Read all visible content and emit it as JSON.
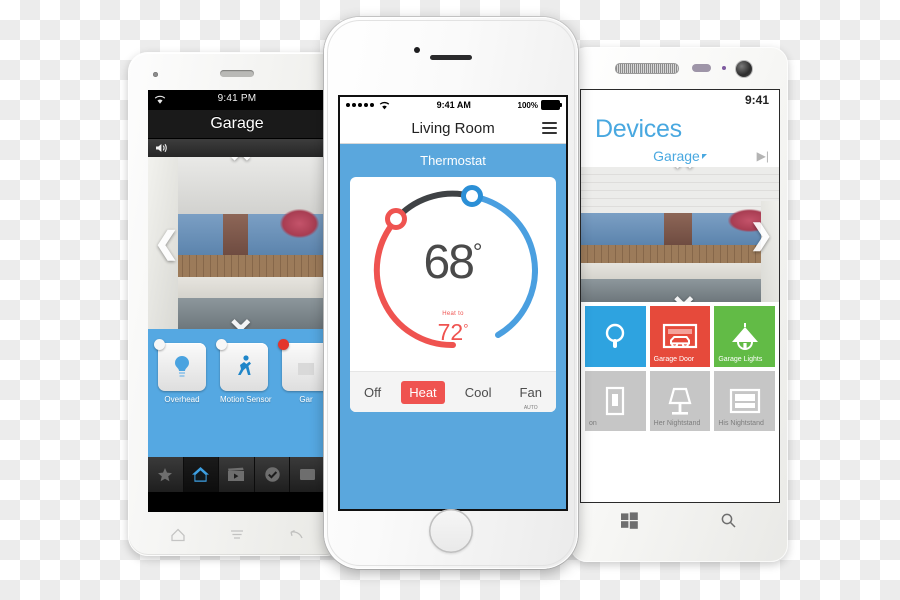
{
  "android_phone": {
    "status": {
      "time": "9:41 PM",
      "wifi_icon": "wifi-icon"
    },
    "title": "Garage",
    "camera_bar": {
      "speaker_icon": "speaker-icon"
    },
    "nav_arrows": {
      "left": "❮",
      "up": "⌃",
      "down": "⌄"
    },
    "tiles": [
      {
        "label": "Overhead",
        "icon": "lightbulb-icon",
        "status_dot": "white"
      },
      {
        "label": "Motion Sensor",
        "icon": "running-person-icon",
        "status_dot": "white"
      },
      {
        "label": "Gar",
        "icon": "garage-icon",
        "status_dot": "red"
      }
    ],
    "tabbar": [
      {
        "icon": "star-icon",
        "active": false
      },
      {
        "icon": "home-icon",
        "active": true
      },
      {
        "icon": "video-clapper-icon",
        "active": false
      },
      {
        "icon": "check-circle-icon",
        "active": false
      },
      {
        "icon": "message-icon",
        "active": false
      }
    ],
    "softkeys": [
      {
        "icon": "home-outline-icon"
      },
      {
        "icon": "menu-lines-icon"
      },
      {
        "icon": "back-arrow-icon"
      }
    ]
  },
  "iphone": {
    "status": {
      "signal_dots": 5,
      "wifi_icon": "wifi-icon",
      "time": "9:41 AM",
      "battery_percent": "100%"
    },
    "nav": {
      "title": "Living Room",
      "menu_icon": "hamburger-menu-icon"
    },
    "section_title": "Thermostat",
    "thermostat": {
      "current_temp": "68",
      "degree_symbol": "°",
      "setpoint_caption": "Heat to",
      "setpoint_temp": "72",
      "modes": [
        {
          "label": "Off",
          "selected": false,
          "sub": ""
        },
        {
          "label": "Heat",
          "selected": true,
          "sub": ""
        },
        {
          "label": "Cool",
          "selected": false,
          "sub": ""
        },
        {
          "label": "Fan",
          "selected": false,
          "sub": "AUTO"
        }
      ],
      "colors": {
        "heat": "#ef5350",
        "cool": "#4a9fe0",
        "idle": "#3f4245",
        "accent_bg": "#5aa7dd"
      }
    },
    "home_button": "home-button"
  },
  "windows_phone": {
    "status": {
      "time": "9:41"
    },
    "header": "Devices",
    "subheader": "Garage",
    "next_icon": "next-page-icon",
    "tiles": [
      {
        "label": "",
        "icon": "thermostat-icon",
        "color": "#2ea3e0"
      },
      {
        "label": "Garage Door",
        "icon": "garage-door-icon",
        "color": "#e64a3b"
      },
      {
        "label": "Garage Lights",
        "icon": "pendant-lamp-icon",
        "color": "#62bb46"
      },
      {
        "label": "on",
        "icon": "switch-icon",
        "color": "#c6c6c6"
      },
      {
        "label": "Her Nightstand",
        "icon": "table-lamp-icon",
        "color": "#c6c6c6"
      },
      {
        "label": "His Nightstand",
        "icon": "bed-icon",
        "color": "#c6c6c6"
      }
    ],
    "softkeys": [
      {
        "icon": "windows-logo-icon"
      },
      {
        "icon": "search-icon"
      }
    ]
  },
  "chart_data": {
    "type": "gauge",
    "title": "Thermostat",
    "current_value": 68,
    "setpoint_heat": 72,
    "unit": "°F",
    "arcs": [
      {
        "name": "heat",
        "color": "#ef5350",
        "start_deg": 140,
        "end_deg": 220
      },
      {
        "name": "idle",
        "color": "#3f4245",
        "start_deg": 220,
        "end_deg": 255
      },
      {
        "name": "cool",
        "color": "#4a9fe0",
        "start_deg": 255,
        "end_deg": 400
      }
    ],
    "handles": [
      {
        "name": "heat-handle",
        "color": "#ef5350",
        "angle_deg": 220
      },
      {
        "name": "cool-handle",
        "color": "#4a9fe0",
        "angle_deg": 255
      }
    ]
  }
}
